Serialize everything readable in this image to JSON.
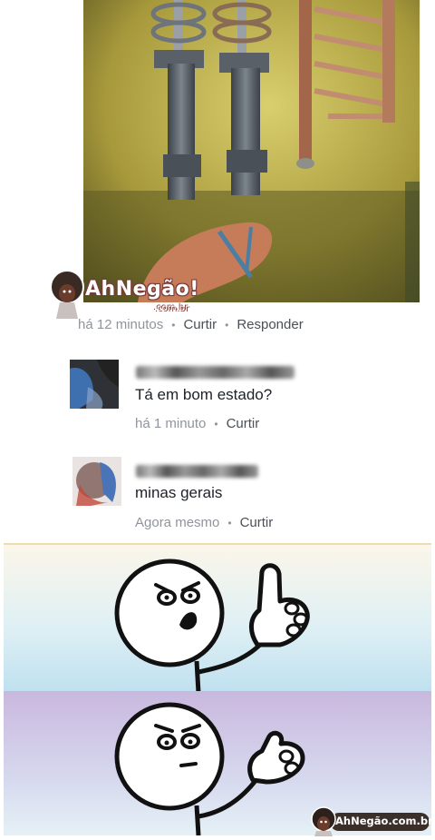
{
  "watermark": {
    "brand": "AhNegão!",
    "sub": ".com.br"
  },
  "photo_comment": {
    "time": "há 12 minutos",
    "like": "Curtir",
    "reply": "Responder"
  },
  "comments": [
    {
      "text": "Tá em bom estado?",
      "time": "há 1 minuto",
      "like": "Curtir"
    },
    {
      "text": "minas gerais",
      "time": "Agora mesmo",
      "like": "Curtir"
    }
  ],
  "logo_badge": {
    "text": "AhNegão.com.br"
  },
  "icons": {
    "watermark": "afro-mascot-icon",
    "badge": "afro-mascot-icon"
  }
}
